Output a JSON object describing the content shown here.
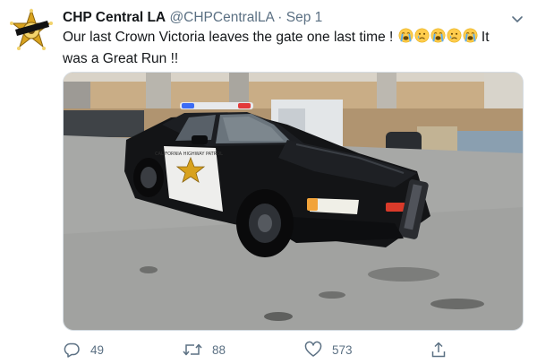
{
  "account": {
    "display_name": "CHP Central LA",
    "handle": "@CHPCentralLA",
    "separator": "·",
    "date": "Sep 1",
    "avatar_icon": "chp-badge-icon"
  },
  "tweet": {
    "text_line1": "Our last Crown Victoria leaves the gate one last time !",
    "text_after_emoji": " It",
    "text_line2": "was a Great Run !!",
    "emojis": [
      "loudly-crying-face",
      "crying-face",
      "loudly-crying-face",
      "crying-face",
      "loudly-crying-face"
    ]
  },
  "media": {
    "kind": "photo",
    "door_badge_text": "CALIFORNIA HIGHWAY PATROL"
  },
  "actions": {
    "reply_count": "49",
    "retweet_count": "88",
    "like_count": "573",
    "reply_icon": "reply-icon",
    "retweet_icon": "retweet-icon",
    "like_icon": "heart-icon",
    "share_icon": "share-icon"
  },
  "colors": {
    "secondary_text": "#5b7083",
    "primary_text": "#14171a",
    "badge_gold": "#d8a21e"
  }
}
